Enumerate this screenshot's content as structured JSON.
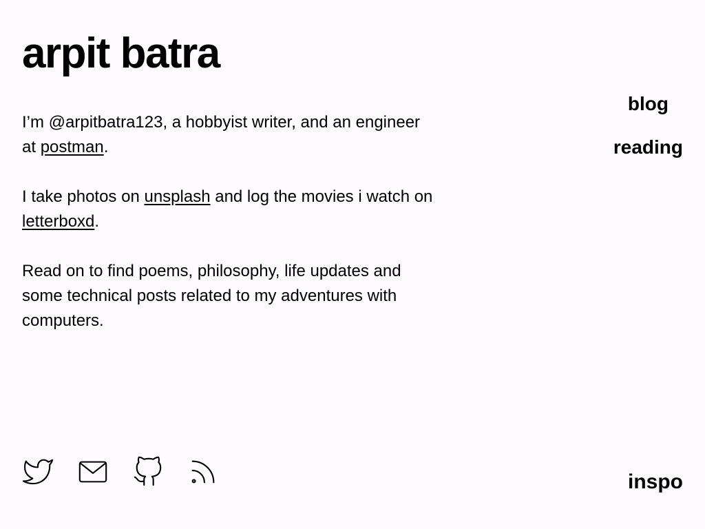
{
  "header": {
    "title": "arpit batra"
  },
  "intro": {
    "p1_text_a": "I’m @arpitbatra123, a hobbyist writer, and an engineer at ",
    "p1_link": "postman",
    "p1_text_b": ".",
    "p2_text_a": "I take photos on ",
    "p2_link_1": "unsplash",
    "p2_text_b": " and log the movies i watch on ",
    "p2_link_2": "letterboxd",
    "p2_text_c": ".",
    "p3_text": "Read on to find poems, philosophy, life updates and some technical posts related to my adventures with computers."
  },
  "nav": {
    "items": [
      {
        "label": "blog"
      },
      {
        "label": "reading"
      }
    ]
  },
  "footer": {
    "icons": [
      "twitter-icon",
      "mail-icon",
      "github-icon",
      "rss-icon"
    ],
    "inspo_label": "inspo"
  },
  "colors": {
    "background": "#fdfbfd",
    "text": "#000000"
  }
}
